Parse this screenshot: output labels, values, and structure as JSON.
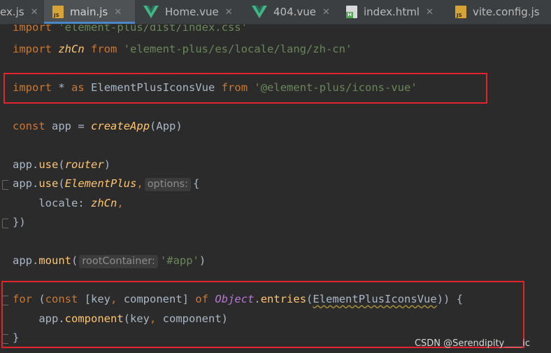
{
  "tabs": [
    {
      "label": "ex.js",
      "icon": "js-file-icon",
      "active": false
    },
    {
      "label": "main.js",
      "icon": "js-file-icon",
      "active": true
    },
    {
      "label": "Home.vue",
      "icon": "vue-file-icon",
      "active": false
    },
    {
      "label": "404.vue",
      "icon": "vue-file-icon",
      "active": false
    },
    {
      "label": "index.html",
      "icon": "html-file-icon",
      "active": false
    },
    {
      "label": "vite.config.js",
      "icon": "js-file-icon",
      "active": false
    }
  ],
  "tab_close_glyph": "✕",
  "icon_text": {
    "js": "JS",
    "html": "H"
  },
  "colors": {
    "keyword": "#cc7832",
    "string": "#6a8759",
    "identifier": "#a9b7c6",
    "function": "#ffc66d",
    "highlight_box": "#e3242b",
    "background": "#2b2b2b",
    "active_tab_underline": "#4a88c7"
  },
  "code": {
    "line0": {
      "kw": "import",
      "str": "'element-plus/dist/index.css'"
    },
    "line1": {
      "kw": "import",
      "name": "zhCn",
      "from": "from",
      "str": "'element-plus/es/locale/lang/zh-cn'"
    },
    "line3": {
      "kw": "import",
      "star": "*",
      "as": "as",
      "name": "ElementPlusIconsVue",
      "from": "from",
      "str": "'@element-plus/icons-vue'"
    },
    "line5": {
      "kw": "const",
      "name": "app",
      "eq": "=",
      "fn": "createApp",
      "open": "(",
      "arg": "App",
      "close": ")"
    },
    "line7": {
      "obj": "app",
      "dot": ".",
      "fn": "use",
      "open": "(",
      "arg": "router",
      "close": ")"
    },
    "line8": {
      "obj": "app",
      "dot": ".",
      "fn": "use",
      "open": "(",
      "arg": "ElementPlus",
      "comma": ",",
      "hint": "options:",
      "brace": "{"
    },
    "line9": {
      "prop": "locale",
      "colon": ":",
      "val": "zhCn",
      "comma": ","
    },
    "line10": {
      "text": "})"
    },
    "line12": {
      "obj": "app",
      "dot": ".",
      "fn": "mount",
      "open": "(",
      "hint": "rootContainer:",
      "str": "'#app'",
      "close": ")"
    },
    "line14": {
      "kw": "for",
      "open": " (",
      "kw2": "const",
      "destruct": "[key",
      "comma": ",",
      "comp": " component]",
      "of": "of",
      "obj": "Object",
      "dot": ".",
      "fn": "entries",
      "arg_open": "(",
      "arg": "ElementPlusIconsVue",
      "rest": ")) {"
    },
    "line15": {
      "obj": "app",
      "dot": ".",
      "fn": "component",
      "args": "(key",
      "comma": ",",
      "rest": " component)"
    },
    "line16": {
      "text": "}"
    }
  },
  "watermark": "CSDN @Serendipity＿＿ic"
}
